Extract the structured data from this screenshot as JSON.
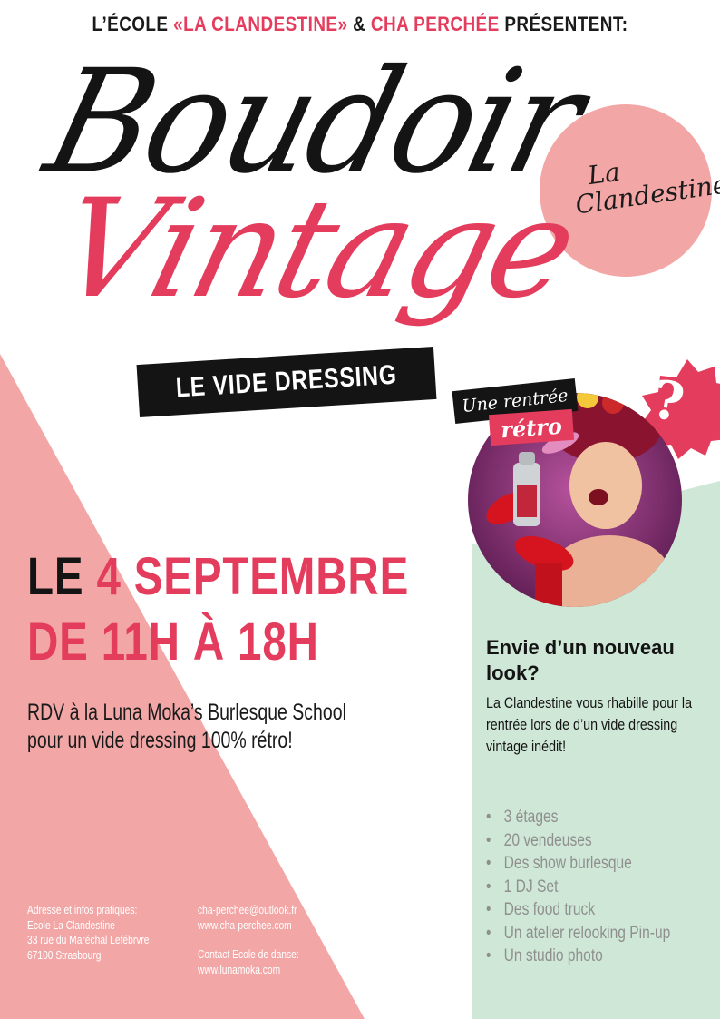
{
  "header": {
    "prefix": "L’ÉCOLE ",
    "school": "«LA CLANDESTINE»",
    "amp": " & ",
    "org": "CHA PERCHÉE",
    "suffix": " PRÉSENTENT:"
  },
  "title": {
    "line1": "Boudoir",
    "line2": "Vintage"
  },
  "banner": "LE VIDE DRESSING",
  "logo": {
    "line1": "La",
    "line2": "Clandestine"
  },
  "tagline": {
    "part1": "Une rentrée",
    "part2": "rétro"
  },
  "question_mark": "?",
  "event": {
    "le": "LE ",
    "date": "4 SEPTEMBRE",
    "hours": "DE 11H À 18H",
    "rdv_line1": "RDV à la Luna Moka’s Burlesque School",
    "rdv_line2": "pour un vide dressing 100% rétro!"
  },
  "side": {
    "heading_line1": "Envie d’un nouveau",
    "heading_line2": "look?",
    "body": "La Clandestine vous rhabille pour la rentrée lors de d’un vide dressing vintage inédit!",
    "features": [
      "3 étages",
      "20 vendeuses",
      "Des show burlesque",
      "1 DJ Set",
      "Des food truck",
      "Un atelier relooking Pin-up",
      "Un studio photo"
    ]
  },
  "contact": {
    "address_label": "Adresse et infos pratiques:",
    "address_line1": "Ecole La Clandestine",
    "address_line2": "33 rue du Maréchal Lefébrvre",
    "address_line3": "67100 Strasbourg",
    "email": "cha-perchee@outlook.fr",
    "website": "www.cha-perchee.com",
    "dance_label": "Contact Ecole de danse:",
    "dance_site": "www.lunamoka.com"
  },
  "colors": {
    "pink": "#e43c5c",
    "salmon": "#f2a7a6",
    "mint": "#cfe7d6",
    "dark": "#141414"
  },
  "icons": [
    "question-badge-icon",
    "photo-portrait",
    "logo-circle"
  ]
}
